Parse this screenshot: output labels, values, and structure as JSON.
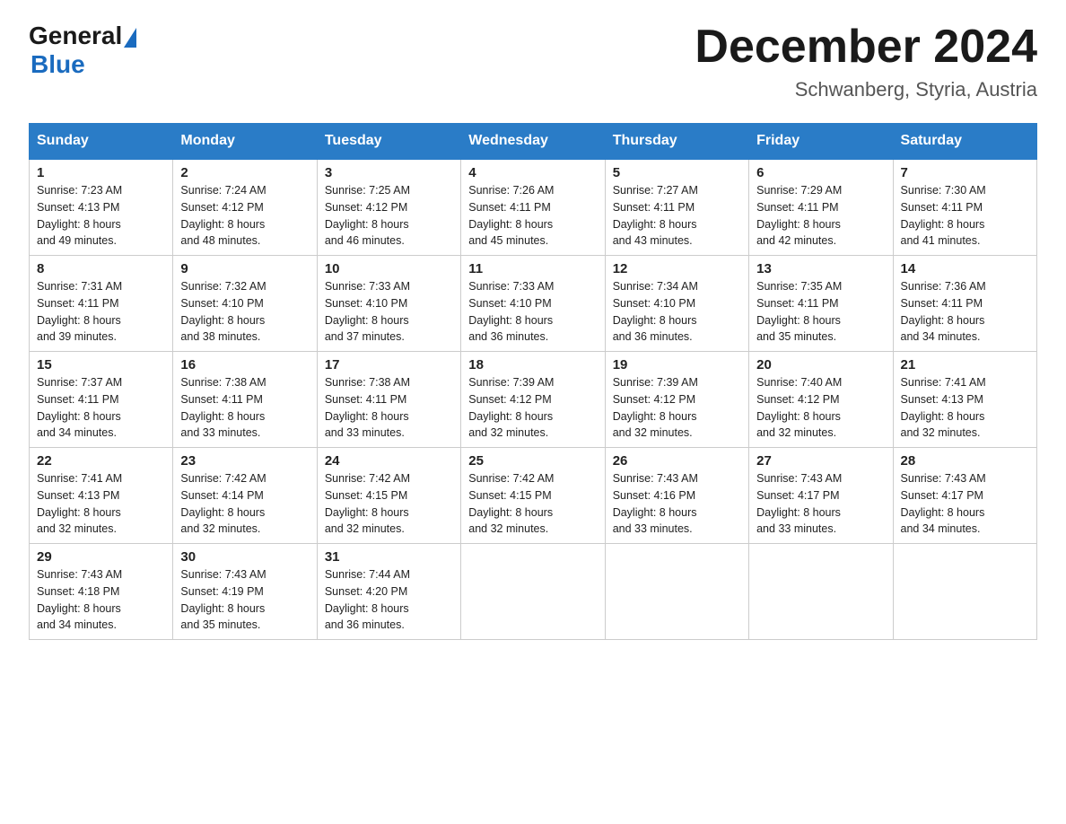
{
  "logo": {
    "general": "General",
    "blue": "Blue"
  },
  "title": "December 2024",
  "subtitle": "Schwanberg, Styria, Austria",
  "weekdays": [
    "Sunday",
    "Monday",
    "Tuesday",
    "Wednesday",
    "Thursday",
    "Friday",
    "Saturday"
  ],
  "weeks": [
    [
      {
        "day": "1",
        "sunrise": "7:23 AM",
        "sunset": "4:13 PM",
        "daylight": "8 hours and 49 minutes."
      },
      {
        "day": "2",
        "sunrise": "7:24 AM",
        "sunset": "4:12 PM",
        "daylight": "8 hours and 48 minutes."
      },
      {
        "day": "3",
        "sunrise": "7:25 AM",
        "sunset": "4:12 PM",
        "daylight": "8 hours and 46 minutes."
      },
      {
        "day": "4",
        "sunrise": "7:26 AM",
        "sunset": "4:11 PM",
        "daylight": "8 hours and 45 minutes."
      },
      {
        "day": "5",
        "sunrise": "7:27 AM",
        "sunset": "4:11 PM",
        "daylight": "8 hours and 43 minutes."
      },
      {
        "day": "6",
        "sunrise": "7:29 AM",
        "sunset": "4:11 PM",
        "daylight": "8 hours and 42 minutes."
      },
      {
        "day": "7",
        "sunrise": "7:30 AM",
        "sunset": "4:11 PM",
        "daylight": "8 hours and 41 minutes."
      }
    ],
    [
      {
        "day": "8",
        "sunrise": "7:31 AM",
        "sunset": "4:11 PM",
        "daylight": "8 hours and 39 minutes."
      },
      {
        "day": "9",
        "sunrise": "7:32 AM",
        "sunset": "4:10 PM",
        "daylight": "8 hours and 38 minutes."
      },
      {
        "day": "10",
        "sunrise": "7:33 AM",
        "sunset": "4:10 PM",
        "daylight": "8 hours and 37 minutes."
      },
      {
        "day": "11",
        "sunrise": "7:33 AM",
        "sunset": "4:10 PM",
        "daylight": "8 hours and 36 minutes."
      },
      {
        "day": "12",
        "sunrise": "7:34 AM",
        "sunset": "4:10 PM",
        "daylight": "8 hours and 36 minutes."
      },
      {
        "day": "13",
        "sunrise": "7:35 AM",
        "sunset": "4:11 PM",
        "daylight": "8 hours and 35 minutes."
      },
      {
        "day": "14",
        "sunrise": "7:36 AM",
        "sunset": "4:11 PM",
        "daylight": "8 hours and 34 minutes."
      }
    ],
    [
      {
        "day": "15",
        "sunrise": "7:37 AM",
        "sunset": "4:11 PM",
        "daylight": "8 hours and 34 minutes."
      },
      {
        "day": "16",
        "sunrise": "7:38 AM",
        "sunset": "4:11 PM",
        "daylight": "8 hours and 33 minutes."
      },
      {
        "day": "17",
        "sunrise": "7:38 AM",
        "sunset": "4:11 PM",
        "daylight": "8 hours and 33 minutes."
      },
      {
        "day": "18",
        "sunrise": "7:39 AM",
        "sunset": "4:12 PM",
        "daylight": "8 hours and 32 minutes."
      },
      {
        "day": "19",
        "sunrise": "7:39 AM",
        "sunset": "4:12 PM",
        "daylight": "8 hours and 32 minutes."
      },
      {
        "day": "20",
        "sunrise": "7:40 AM",
        "sunset": "4:12 PM",
        "daylight": "8 hours and 32 minutes."
      },
      {
        "day": "21",
        "sunrise": "7:41 AM",
        "sunset": "4:13 PM",
        "daylight": "8 hours and 32 minutes."
      }
    ],
    [
      {
        "day": "22",
        "sunrise": "7:41 AM",
        "sunset": "4:13 PM",
        "daylight": "8 hours and 32 minutes."
      },
      {
        "day": "23",
        "sunrise": "7:42 AM",
        "sunset": "4:14 PM",
        "daylight": "8 hours and 32 minutes."
      },
      {
        "day": "24",
        "sunrise": "7:42 AM",
        "sunset": "4:15 PM",
        "daylight": "8 hours and 32 minutes."
      },
      {
        "day": "25",
        "sunrise": "7:42 AM",
        "sunset": "4:15 PM",
        "daylight": "8 hours and 32 minutes."
      },
      {
        "day": "26",
        "sunrise": "7:43 AM",
        "sunset": "4:16 PM",
        "daylight": "8 hours and 33 minutes."
      },
      {
        "day": "27",
        "sunrise": "7:43 AM",
        "sunset": "4:17 PM",
        "daylight": "8 hours and 33 minutes."
      },
      {
        "day": "28",
        "sunrise": "7:43 AM",
        "sunset": "4:17 PM",
        "daylight": "8 hours and 34 minutes."
      }
    ],
    [
      {
        "day": "29",
        "sunrise": "7:43 AM",
        "sunset": "4:18 PM",
        "daylight": "8 hours and 34 minutes."
      },
      {
        "day": "30",
        "sunrise": "7:43 AM",
        "sunset": "4:19 PM",
        "daylight": "8 hours and 35 minutes."
      },
      {
        "day": "31",
        "sunrise": "7:44 AM",
        "sunset": "4:20 PM",
        "daylight": "8 hours and 36 minutes."
      },
      null,
      null,
      null,
      null
    ]
  ],
  "labels": {
    "sunrise": "Sunrise:",
    "sunset": "Sunset:",
    "daylight": "Daylight:"
  }
}
